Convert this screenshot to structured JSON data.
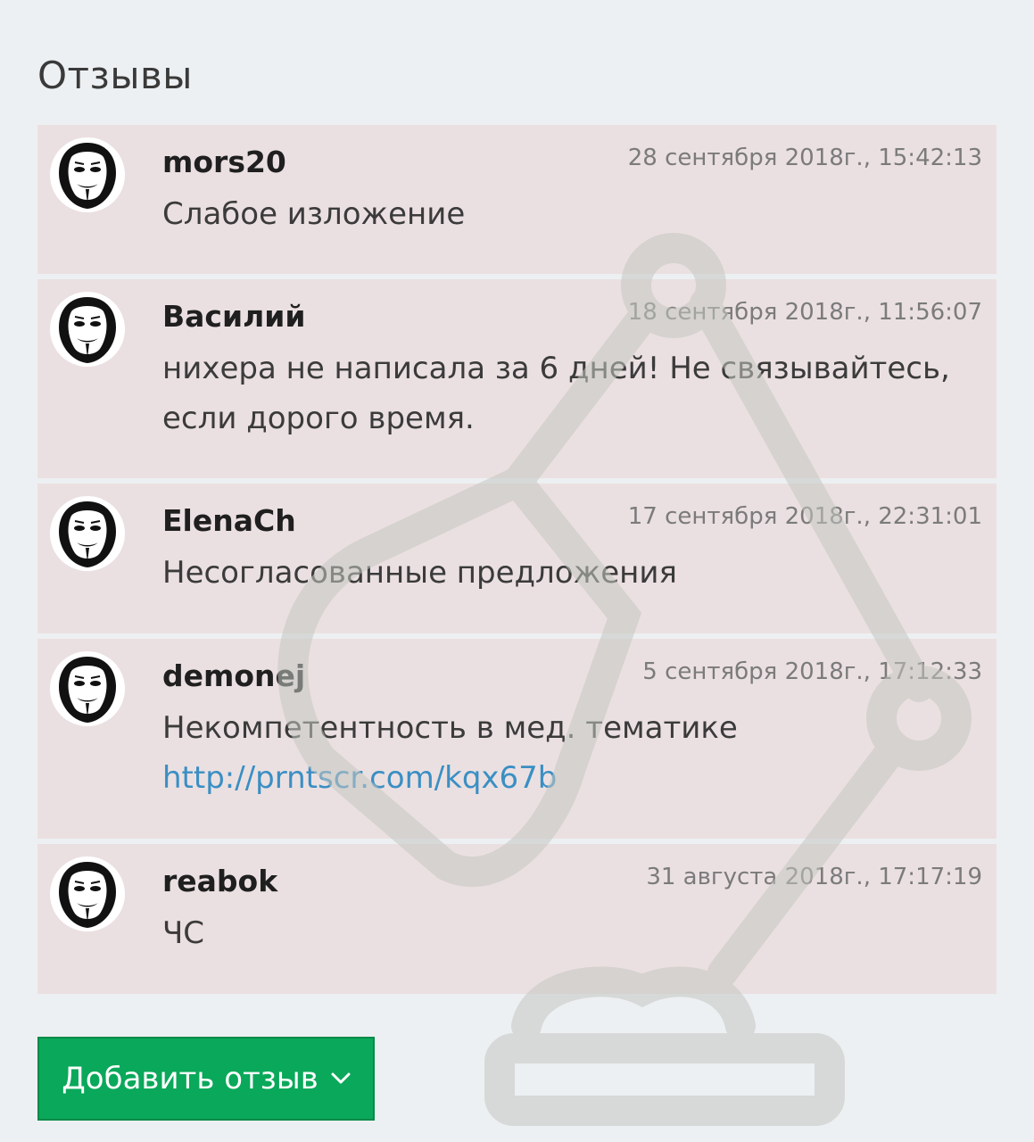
{
  "section": {
    "title": "Отзывы"
  },
  "reviews": [
    {
      "author": "mors20",
      "date": "28 сентября 2018г., 15:42:13",
      "text": "Слабое изложение"
    },
    {
      "author": "Василий",
      "date": "18 сентября 2018г., 11:56:07",
      "text": "нихера не написала за 6 дней! Не связывайтесь, если дорого время."
    },
    {
      "author": "ElenaCh",
      "date": "17 сентября 2018г., 22:31:01",
      "text": "Несогласованные предложения"
    },
    {
      "author": "demonej",
      "date": "5 сентября 2018г., 17:12:33",
      "text": "Некомпетентность в мед. тематике",
      "link": "http://prntscr.com/kqx67b"
    },
    {
      "author": "reabok",
      "date": "31 августа 2018г., 17:17:19",
      "text": "ЧС"
    }
  ],
  "add_button": {
    "label": "Добавить отзыв",
    "icon": "chevron-down-icon"
  },
  "colors": {
    "card_bg": "#ebe0e1",
    "button_bg": "#0aa85a",
    "link": "#3a8fc4",
    "page_bg": "#edf0f2"
  }
}
